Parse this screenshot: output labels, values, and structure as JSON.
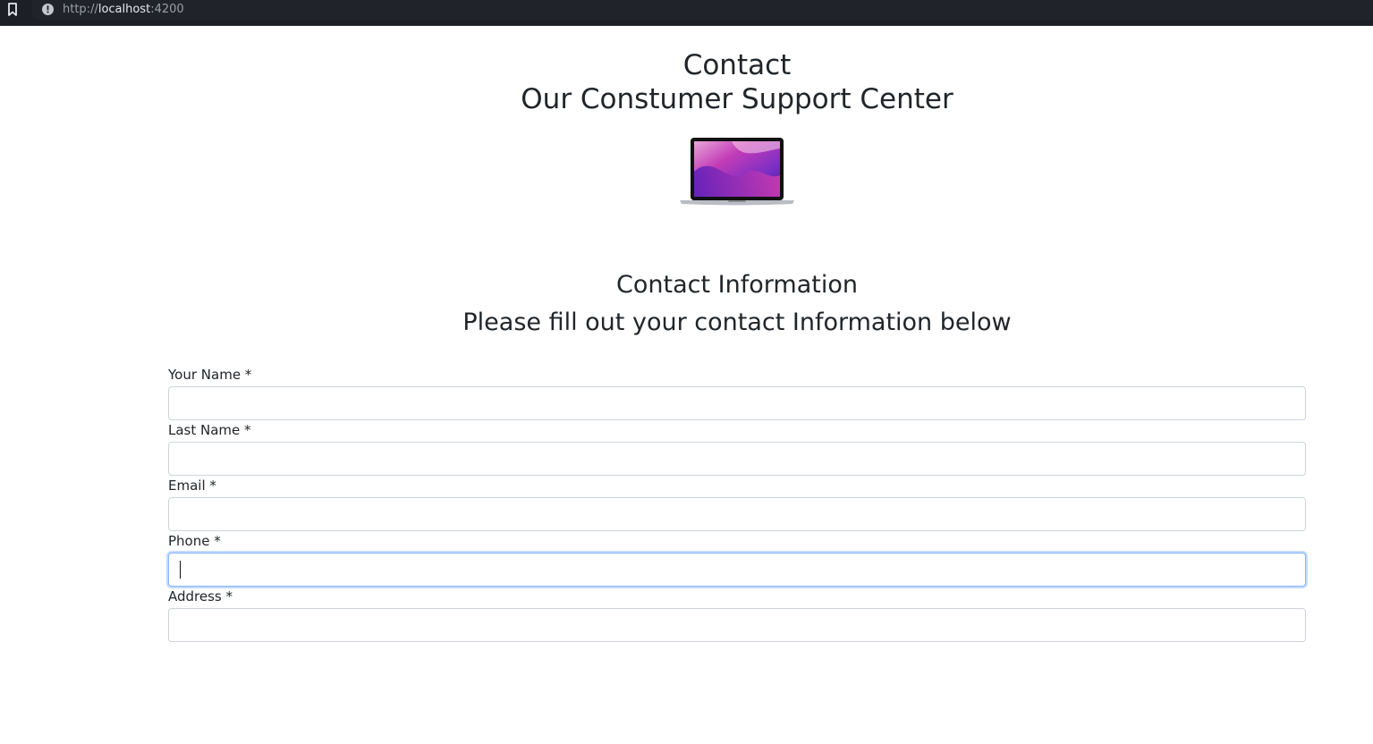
{
  "browser": {
    "url_scheme": "http://",
    "url_host": "localhost",
    "url_port": ":4200"
  },
  "header": {
    "title": "Contact",
    "subtitle": "Our Constumer Support Center"
  },
  "section": {
    "title": "Contact Information",
    "subtitle": "Please fill out your contact Information below"
  },
  "form": {
    "fields": [
      {
        "label": "Your Name *",
        "value": ""
      },
      {
        "label": "Last Name *",
        "value": ""
      },
      {
        "label": "Email *",
        "value": ""
      },
      {
        "label": "Phone *",
        "value": ""
      },
      {
        "label": "Address *",
        "value": ""
      }
    ]
  },
  "colors": {
    "topbar": "#1c1f26",
    "text": "#212529",
    "input_border": "#ced4da",
    "focus_border": "#86b7fe"
  }
}
